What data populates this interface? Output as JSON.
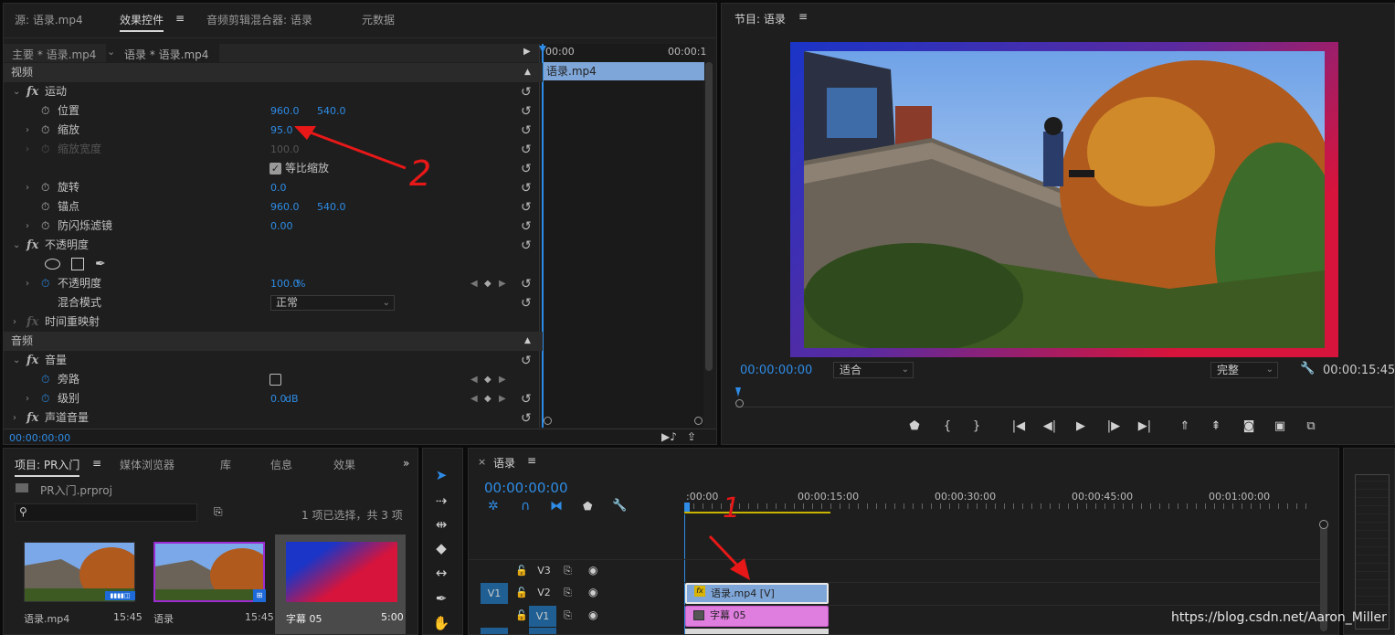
{
  "colors": {
    "accent": "#2e8ce6",
    "clip_video": "#7fa6d8",
    "clip_title": "#e07ee0",
    "gradient_a": "#1a35c8",
    "gradient_b": "#d6143c",
    "annotation": "#e81818",
    "work_area": "#c8b400"
  },
  "source_panel": {
    "tabs": [
      "源: 语录.mp4",
      "效果控件",
      "音频剪辑混合器: 语录",
      "元数据"
    ],
    "menu_icon": "≡"
  },
  "effect_controls": {
    "master_label": "主要 * 语录.mp4",
    "clip_label": "语录 * 语录.mp4",
    "mini_timeline": {
      "start": "00:00",
      "end": "00:00:1",
      "clip_name": "语录.mp4"
    },
    "video_header": "视频",
    "motion": {
      "label": "运动",
      "position_label": "位置",
      "position_x": "960.0",
      "position_y": "540.0",
      "scale_label": "缩放",
      "scale": "95.0",
      "scale_width_label": "缩放宽度",
      "scale_width": "100.0",
      "uniform_label": "等比缩放",
      "rotation_label": "旋转",
      "rotation": "0.0",
      "anchor_label": "锚点",
      "anchor_x": "960.0",
      "anchor_y": "540.0",
      "flicker_label": "防闪烁滤镜",
      "flicker": "0.00"
    },
    "opacity": {
      "label": "不透明度",
      "opacity_label": "不透明度",
      "value": "100.0",
      "unit": "%",
      "blend_label": "混合模式",
      "blend_value": "正常"
    },
    "time_remap": "时间重映射",
    "audio_header": "音频",
    "volume": {
      "label": "音量",
      "bypass_label": "旁路",
      "level_label": "级别",
      "level_value": "0.0",
      "level_unit": "dB"
    },
    "channel_volume": "声道音量",
    "timecode": "00:00:00:00"
  },
  "program": {
    "title": "节目: 语录",
    "timecode": "00:00:00:00",
    "fit": "适合",
    "quality": "完整",
    "duration": "00:00:15:45"
  },
  "project": {
    "tabs": [
      "项目: PR入门",
      "媒体浏览器",
      "库",
      "信息",
      "效果"
    ],
    "file": "PR入门.prproj",
    "selection": "1 项已选择，共 3 项",
    "items": [
      {
        "name": "语录.mp4",
        "dur": "15:45"
      },
      {
        "name": "语录",
        "dur": "15:45"
      },
      {
        "name": "字幕 05",
        "dur": "5:00"
      }
    ]
  },
  "timeline": {
    "title": "语录",
    "timecode": "00:00:00:00",
    "ruler": [
      ":00:00",
      "00:00:15:00",
      "00:00:30:00",
      "00:00:45:00",
      "00:01:00:00"
    ],
    "tracks": [
      {
        "name": "V3",
        "src": ""
      },
      {
        "name": "V2",
        "src": "V1"
      },
      {
        "name": "V1",
        "src": ""
      }
    ],
    "clips": [
      {
        "name": "语录.mp4 [V]",
        "badge": "fx"
      },
      {
        "name": "字幕 05",
        "badge": ""
      }
    ]
  },
  "annotations": {
    "one": "1",
    "two": "2"
  },
  "watermark": "https://blog.csdn.net/Aaron_Miller"
}
